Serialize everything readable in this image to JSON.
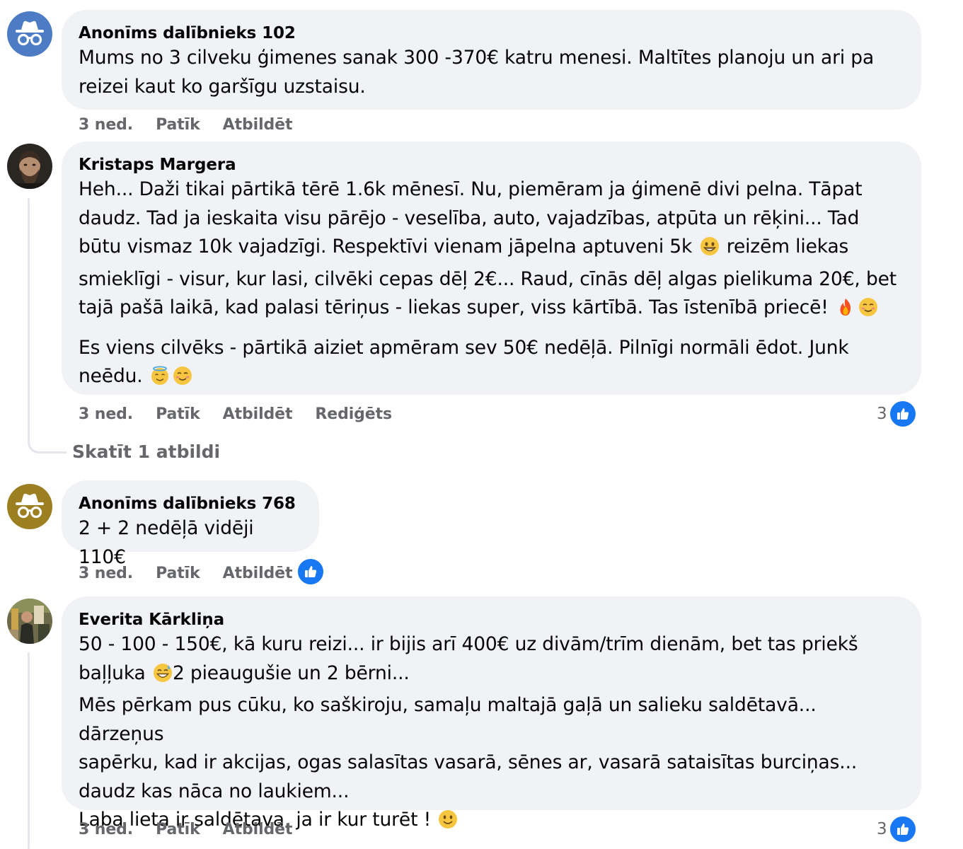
{
  "colors": {
    "bubble_bg": "#f0f2f5",
    "meta_text": "#65676b",
    "like_blue": "#1877f2",
    "anon_avatar_1": "#4d7cc4",
    "anon_avatar_2": "#9c7f20"
  },
  "comments": [
    {
      "author": "Anonīms dalībnieks 102",
      "avatar_icon": "incognito-icon",
      "paragraphs": [
        [
          "Mums no 3 cilveku ģimenes sanak 300 -370€ katru menesi. Maltītes planoju un ari pa reizei kaut ko garšīgu uzstaisu."
        ]
      ],
      "time": "3 ned.",
      "like_label": "Patīk",
      "reply_label": "Atbildēt"
    },
    {
      "author": "Kristaps Margera",
      "avatar_icon": "profile-photo",
      "paragraphs": [
        [
          "Heh... Daži tikai pārtikā tērē 1.6k mēnesī. Nu, piemēram ja ģimenē divi pelna. Tāpat daudz. Tad ja ieskaita visu pārējo - veselība, auto, vajadzības, atpūta un rēķini... Tad būtu vismaz 10k vajadzīgi. Respektīvi vienam jāpelna aptuveni 5k",
          "reizēm liekas smieklīgi - visur, kur lasi, cilvēki cepas dēļ 2€... Raud, cīnās dēļ algas pielikuma 20€, bet tajā pašā laikā, kad palasi tēriņus - liekas super, viss kārtībā. Tas īstenībā priecē!"
        ],
        [
          "Es viens cilvēks - pārtikā aiziet apmēram sev 50€ nedēļā. Pilnīgi normāli ēdot. Junk neēdu."
        ]
      ],
      "emojis": [
        "grinning-face-emoji",
        "fire-emoji",
        "smiling-face-emoji",
        "halo-face-emoji",
        "smiling-face-emoji"
      ],
      "time": "3 ned.",
      "like_label": "Patīk",
      "reply_label": "Atbildēt",
      "edited_label": "Rediģēts",
      "reaction_count": "3",
      "view_replies": "Skatīt 1 atbildi"
    },
    {
      "author": "Anonīms dalībnieks 768",
      "avatar_icon": "incognito-icon",
      "paragraphs": [
        [
          "2 + 2 nedēļā vidēji 110€"
        ]
      ],
      "time": "3 ned.",
      "like_label": "Patīk",
      "reply_label": "Atbildēt"
    },
    {
      "author": "Everita Kārkliņa",
      "avatar_icon": "profile-photo",
      "lines": [
        "50 - 100 - 150€, kā kuru reizi... ir bijis arī 400€ uz divām/trīm dienām, bet tas priekš",
        "baļļuka",
        "2 pieaugušie un 2 bērni...",
        "Mēs pērkam pus cūku, ko saškiroju, samaļu maltajā gaļā un salieku saldētavā... dārzeņus",
        "sapērku, kad ir akcijas, ogas salasītas vasarā, sēnes ar, vasarā sataisītas burciņas...",
        "daudz kas nāca no laukiem...",
        "Laba lieta ir saldētava, ja ir kur turēt !"
      ],
      "emojis": [
        "grinning-sweat-emoji",
        "slightly-smiling-emoji"
      ],
      "time": "3 ned.",
      "like_label": "Patīk",
      "reply_label": "Atbildēt",
      "reaction_count": "3"
    }
  ]
}
